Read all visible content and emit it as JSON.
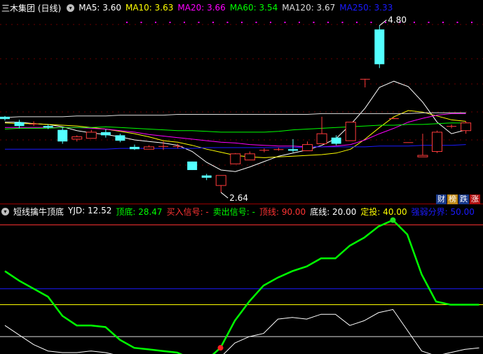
{
  "top_header": {
    "name": "三木集团 (日线)",
    "ma": [
      {
        "label": "MA5: 3.60",
        "color": "#ffffff"
      },
      {
        "label": "MA10: 3.63",
        "color": "#ffff00"
      },
      {
        "label": "MA20: 3.66",
        "color": "#ff00ff"
      },
      {
        "label": "MA60: 3.54",
        "color": "#00ff00"
      },
      {
        "label": "MA120: 3.67",
        "color": "#dddddd"
      },
      {
        "label": "MA250: 3.33",
        "color": "#1a1aff"
      }
    ]
  },
  "badges": [
    {
      "label": "财",
      "bg": "#1a3a8a",
      "color": "#ffffff"
    },
    {
      "label": "榜",
      "bg": "#c08a1a",
      "color": "#ffffff"
    },
    {
      "label": "跌",
      "bg": "#1a3a8a",
      "color": "#ffffff"
    },
    {
      "label": "涨",
      "bg": "#b01010",
      "color": "#ffffff"
    }
  ],
  "bottom_header": {
    "title": "短线擒牛顶底",
    "items": [
      {
        "label": "YJD: 12.52",
        "color": "#ffffff"
      },
      {
        "label": "顶底: 28.47",
        "color": "#00ff00"
      },
      {
        "label": "买入信号: -",
        "color": "#ff3333"
      },
      {
        "label": "卖出信号: -",
        "color": "#00ff00"
      },
      {
        "label": "顶线: 90.00",
        "color": "#ff3333"
      },
      {
        "label": "底线: 20.00",
        "color": "#ffffff"
      },
      {
        "label": "定投: 40.00",
        "color": "#ffff00"
      },
      {
        "label": "强弱分界: 50.00",
        "color": "#1a1aff"
      }
    ]
  },
  "chart_data": [
    {
      "type": "candlestick",
      "high_label": "4.80",
      "low_label": "2.64",
      "colors": {
        "up": "#ff3b3b",
        "down": "#54ffff"
      },
      "candles": [
        {
          "open": 3.62,
          "close": 3.59,
          "high": 3.63,
          "low": 3.57
        },
        {
          "open": 3.55,
          "close": 3.5,
          "high": 3.58,
          "low": 3.47
        },
        {
          "open": 3.53,
          "close": 3.53,
          "high": 3.56,
          "low": 3.5
        },
        {
          "open": 3.5,
          "close": 3.48,
          "high": 3.52,
          "low": 3.46
        },
        {
          "open": 3.45,
          "close": 3.3,
          "high": 3.48,
          "low": 3.27
        },
        {
          "open": 3.33,
          "close": 3.36,
          "high": 3.38,
          "low": 3.3
        },
        {
          "open": 3.34,
          "close": 3.42,
          "high": 3.45,
          "low": 3.34
        },
        {
          "open": 3.42,
          "close": 3.38,
          "high": 3.46,
          "low": 3.35
        },
        {
          "open": 3.38,
          "close": 3.31,
          "high": 3.4,
          "low": 3.29
        },
        {
          "open": 3.23,
          "close": 3.2,
          "high": 3.26,
          "low": 3.19
        },
        {
          "open": 3.2,
          "close": 3.23,
          "high": 3.25,
          "low": 3.2
        },
        {
          "open": 3.24,
          "close": 3.24,
          "high": 3.3,
          "low": 3.19
        },
        {
          "open": 3.24,
          "close": 3.24,
          "high": 3.27,
          "low": 3.21
        },
        {
          "open": 3.04,
          "close": 2.93,
          "high": 3.04,
          "low": 2.93
        },
        {
          "open": 2.86,
          "close": 2.83,
          "high": 2.88,
          "low": 2.8
        },
        {
          "open": 2.73,
          "close": 2.86,
          "high": 2.86,
          "low": 2.64
        },
        {
          "open": 3.01,
          "close": 3.14,
          "high": 3.15,
          "low": 3.01
        },
        {
          "open": 3.06,
          "close": 3.14,
          "high": 3.17,
          "low": 3.06
        },
        {
          "open": 3.19,
          "close": 3.19,
          "high": 3.21,
          "low": 3.16
        },
        {
          "open": 3.19,
          "close": 3.2,
          "high": 3.22,
          "low": 3.18
        },
        {
          "open": 3.2,
          "close": 3.18,
          "high": 3.33,
          "low": 3.16
        },
        {
          "open": 3.18,
          "close": 3.26,
          "high": 3.3,
          "low": 3.18
        },
        {
          "open": 3.27,
          "close": 3.4,
          "high": 3.62,
          "low": 3.27
        },
        {
          "open": 3.35,
          "close": 3.27,
          "high": 3.38,
          "low": 3.25
        },
        {
          "open": 3.31,
          "close": 3.55,
          "high": 3.55,
          "low": 3.31
        },
        {
          "open": 4.11,
          "close": 4.11,
          "high": 4.11,
          "low": 4.0
        },
        {
          "open": 4.75,
          "close": 4.3,
          "high": 4.8,
          "low": 4.25
        },
        {
          "open": 3.6,
          "close": 3.6,
          "high": 3.61,
          "low": 3.59
        },
        {
          "open": 3.29,
          "close": 3.29,
          "high": 3.29,
          "low": 3.29
        },
        {
          "open": 3.1,
          "close": 3.12,
          "high": 3.4,
          "low": 3.1
        },
        {
          "open": 3.17,
          "close": 3.42,
          "high": 3.44,
          "low": 3.15
        },
        {
          "open": 3.5,
          "close": 3.5,
          "high": 3.52,
          "low": 3.47
        },
        {
          "open": 3.44,
          "close": 3.54,
          "high": 3.56,
          "low": 3.4
        }
      ],
      "ma": [
        {
          "name": "MA5",
          "color": "#ffffff",
          "values": [
            3.55,
            3.55,
            3.53,
            3.52,
            3.49,
            3.44,
            3.41,
            3.39,
            3.36,
            3.32,
            3.3,
            3.28,
            3.25,
            3.17,
            3.03,
            2.93,
            2.91,
            2.97,
            3.04,
            3.11,
            3.15,
            3.19,
            3.25,
            3.34,
            3.52,
            3.73,
            4.0,
            4.08,
            4.01,
            3.81,
            3.55,
            3.4,
            3.45
          ]
        },
        {
          "name": "MA10",
          "color": "#ffff00",
          "values": [
            3.54,
            3.53,
            3.53,
            3.52,
            3.51,
            3.5,
            3.48,
            3.46,
            3.43,
            3.4,
            3.36,
            3.31,
            3.29,
            3.25,
            3.2,
            3.16,
            3.12,
            3.1,
            3.09,
            3.1,
            3.11,
            3.12,
            3.13,
            3.15,
            3.2,
            3.33,
            3.48,
            3.62,
            3.7,
            3.68,
            3.63,
            3.58,
            3.56
          ]
        },
        {
          "name": "MA20",
          "color": "#ff00ff",
          "values": [
            3.48,
            3.48,
            3.48,
            3.48,
            3.48,
            3.48,
            3.47,
            3.46,
            3.44,
            3.42,
            3.39,
            3.37,
            3.35,
            3.33,
            3.31,
            3.29,
            3.28,
            3.26,
            3.25,
            3.24,
            3.24,
            3.23,
            3.23,
            3.24,
            3.26,
            3.32,
            3.4,
            3.47,
            3.55,
            3.6,
            3.64,
            3.66,
            3.66
          ]
        },
        {
          "name": "MA60",
          "color": "#00ff00",
          "values": [
            3.46,
            3.47,
            3.47,
            3.47,
            3.48,
            3.48,
            3.48,
            3.49,
            3.48,
            3.47,
            3.46,
            3.45,
            3.44,
            3.44,
            3.43,
            3.42,
            3.42,
            3.42,
            3.42,
            3.43,
            3.45,
            3.46,
            3.47,
            3.48,
            3.49,
            3.5,
            3.51,
            3.51,
            3.52,
            3.52,
            3.53,
            3.54,
            3.54
          ]
        },
        {
          "name": "MA120",
          "color": "#dddddd",
          "values": [
            3.61,
            3.62,
            3.62,
            3.62,
            3.62,
            3.63,
            3.63,
            3.63,
            3.64,
            3.64,
            3.64,
            3.64,
            3.65,
            3.65,
            3.65,
            3.65,
            3.65,
            3.65,
            3.65,
            3.65,
            3.65,
            3.65,
            3.66,
            3.66,
            3.66,
            3.66,
            3.66,
            3.66,
            3.66,
            3.67,
            3.67,
            3.67,
            3.67
          ]
        },
        {
          "name": "MA250",
          "color": "#1a1aff",
          "values": [
            3.2,
            3.2,
            3.2,
            3.2,
            3.2,
            3.2,
            3.2,
            3.2,
            3.21,
            3.21,
            3.21,
            3.21,
            3.21,
            3.21,
            3.22,
            3.22,
            3.22,
            3.22,
            3.22,
            3.22,
            3.22,
            3.23,
            3.23,
            3.23,
            3.23,
            3.23,
            3.24,
            3.24,
            3.24,
            3.25,
            3.25,
            3.25,
            3.26
          ]
        }
      ]
    },
    {
      "type": "line",
      "ylim": [
        10,
        95
      ],
      "ref_lines": [
        {
          "value": 90,
          "color": "#ff3333"
        },
        {
          "value": 50,
          "color": "#1a1aff"
        },
        {
          "value": 40,
          "color": "#ffff00"
        },
        {
          "value": 20,
          "color": "#dddddd"
        }
      ],
      "series": [
        {
          "name": "顶底",
          "color": "#00ff00",
          "values": [
            61,
            55,
            50,
            45,
            33,
            27,
            27,
            26,
            18,
            13,
            12,
            11,
            10,
            6,
            5,
            13,
            30,
            42,
            52,
            57,
            61,
            64,
            69,
            69,
            77,
            82,
            89,
            93,
            84,
            59,
            42,
            40,
            40,
            40
          ]
        },
        {
          "name": "YJD",
          "color": "#ffffff",
          "values": [
            27,
            21,
            15,
            11,
            10,
            10,
            11,
            10,
            8,
            8,
            8,
            8,
            8,
            6,
            6,
            7,
            16,
            20,
            22,
            31,
            32,
            31,
            34,
            34,
            27,
            30,
            35,
            37,
            24,
            11,
            8,
            10,
            12,
            13
          ]
        }
      ],
      "signals": [
        {
          "kind": "buy",
          "series": "顶底",
          "index": 15,
          "color": "#ff2020"
        },
        {
          "kind": "sell",
          "series": "顶底",
          "index": 27,
          "color": "#20e020"
        }
      ]
    }
  ]
}
